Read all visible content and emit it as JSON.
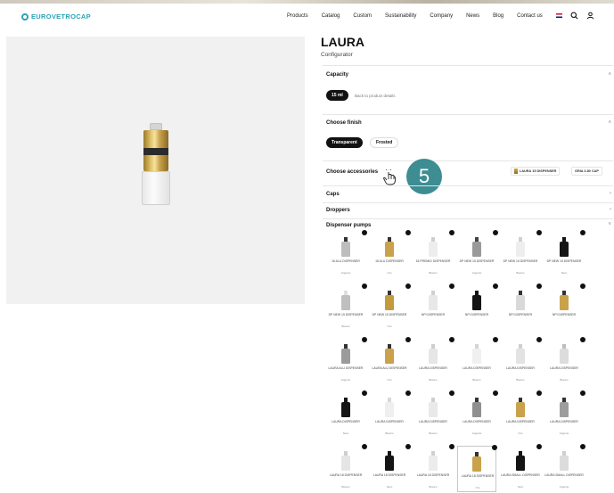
{
  "header": {
    "logo": "EUROVETROCAP",
    "nav": [
      "Products",
      "Catalog",
      "Custom",
      "Sustainability",
      "Company",
      "News",
      "Blog",
      "Contact us"
    ]
  },
  "product": {
    "title": "LAURA",
    "subtitle": "Configurator"
  },
  "capacity": {
    "label": "Capacity",
    "selected": "15 ml",
    "back_link": "Back to product details"
  },
  "finish": {
    "label": "Choose finish",
    "options": [
      "Transparent",
      "Frosted"
    ],
    "selected": "Transparent"
  },
  "accessories": {
    "label": "Choose accessories",
    "dropdown_1": "LAURA 15 DISPENSER",
    "dropdown_2": "GRIA 3.80 CAP",
    "step_number": "5"
  },
  "categories": {
    "caps": "Caps",
    "droppers": "Droppers",
    "pumps": "Dispenser pumps"
  },
  "pumps": [
    {
      "name": "15 ALU DISPENSER",
      "finish": "Argento",
      "color": "#bdbdbd",
      "tip": "#333"
    },
    {
      "name": "15 ALU DISPENSER",
      "finish": "Oro",
      "color": "#c9a24b",
      "tip": "#333"
    },
    {
      "name": "18 PREMIO DISPENSER",
      "finish": "Bianco",
      "color": "#ededed",
      "tip": "#cfcfcf"
    },
    {
      "name": "DP NEW 15 DISPENSER",
      "finish": "Argento",
      "color": "#9a9a9a",
      "tip": "#444"
    },
    {
      "name": "DP NEW 15 DISPENSER",
      "finish": "Bianco",
      "color": "#eeeeee",
      "tip": "#d0d0d0"
    },
    {
      "name": "DP NEW 15 DISPENSER",
      "finish": "Nero",
      "color": "#151515",
      "tip": "#151515"
    },
    {
      "name": "DP NEW 15 DISPENSER",
      "finish": "Bianco",
      "color": "#bfbfbf",
      "tip": "#e0e0e0"
    },
    {
      "name": "DP NEW 15 DISPENSER",
      "finish": "Oro",
      "color": "#c49a3f",
      "tip": "#333"
    },
    {
      "name": "NPI DISPENSER",
      "finish": "",
      "color": "#e8e8e8",
      "tip": "#d0d0d0"
    },
    {
      "name": "NPI DISPENSER",
      "finish": "",
      "color": "#141414",
      "tip": "#141414"
    },
    {
      "name": "NPI DISPENSER",
      "finish": "",
      "color": "#d9d9d9",
      "tip": "#333"
    },
    {
      "name": "NPI DISPENSER",
      "finish": "",
      "color": "#c9a24b",
      "tip": "#333"
    },
    {
      "name": "LAURA ALU DISPENSER",
      "finish": "Argento",
      "color": "#9b9b9b",
      "tip": "#333"
    },
    {
      "name": "LAURA ALU DISPENSER",
      "finish": "Oro",
      "color": "#c9a24b",
      "tip": "#333"
    },
    {
      "name": "LAURA DISPENSER",
      "finish": "Bianco",
      "color": "#e6e6e6",
      "tip": "#cfcfcf"
    },
    {
      "name": "LAURA DISPENSER",
      "finish": "Bianco",
      "color": "#f0f0f0",
      "tip": "#d5d5d5"
    },
    {
      "name": "LAURA DISPENSER",
      "finish": "Bianco",
      "color": "#e3e3e3",
      "tip": "#cfcfcf"
    },
    {
      "name": "LAURA DISPENSER",
      "finish": "Bianco",
      "color": "#dcdcdc",
      "tip": "#bdbdbd"
    },
    {
      "name": "LAURA DISPENSER",
      "finish": "Nero",
      "color": "#151515",
      "tip": "#151515"
    },
    {
      "name": "LAURA DISPENSER",
      "finish": "Bianco",
      "color": "#efefef",
      "tip": "#d8d8d8"
    },
    {
      "name": "LAURA DISPENSER",
      "finish": "Bianco",
      "color": "#e9e9e9",
      "tip": "#cfcfcf"
    },
    {
      "name": "LAURA DISPENSER",
      "finish": "Argento",
      "color": "#8f8f8f",
      "tip": "#333"
    },
    {
      "name": "LAURA DISPENSER",
      "finish": "Oro",
      "color": "#c9a24b",
      "tip": "#333"
    },
    {
      "name": "LAURA DISPENSER",
      "finish": "Argento",
      "color": "#9d9d9d",
      "tip": "#333"
    },
    {
      "name": "LAURA 18 DISPENSER",
      "finish": "Bianco",
      "color": "#e5e5e5",
      "tip": "#cfcfcf"
    },
    {
      "name": "LAURA 18 DISPENSER",
      "finish": "Nero",
      "color": "#141414",
      "tip": "#141414"
    },
    {
      "name": "LAURA 18 DISPENSER",
      "finish": "Bianco",
      "color": "#ececec",
      "tip": "#d0d0d0"
    },
    {
      "name": "LAURA 18 DISPENSER",
      "finish": "Oro",
      "color": "#c9a24b",
      "tip": "#333"
    },
    {
      "name": "LAURA SMALL DISPENSER",
      "finish": "Nero",
      "color": "#141414",
      "tip": "#141414"
    },
    {
      "name": "LAURA SMALL DISPENSER",
      "finish": "Argento",
      "color": "#dcdcdc",
      "tip": "#cfcfcf"
    }
  ],
  "selected_pump_index": 27,
  "colors": {
    "accent": "#2aa3b5",
    "badge": "#3d8d93",
    "dark": "#111111",
    "panel": "#f1f1f1"
  }
}
